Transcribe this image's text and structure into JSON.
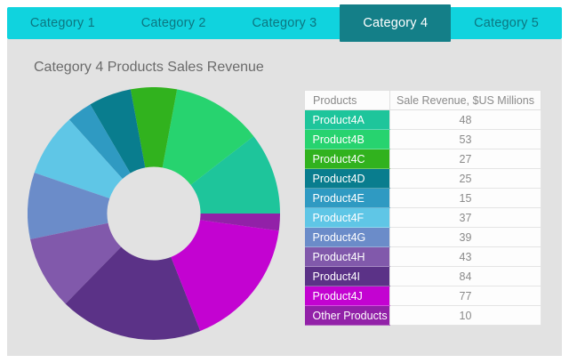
{
  "tabs": {
    "items": [
      {
        "label": "Category 1"
      },
      {
        "label": "Category 2"
      },
      {
        "label": "Category 3"
      },
      {
        "label": "Category 4"
      },
      {
        "label": "Category 5"
      }
    ],
    "active_index": 3
  },
  "main": {
    "title": "Category 4 Products Sales Revenue"
  },
  "table": {
    "headers": [
      "Products",
      "Sale Revenue, $US Millions"
    ],
    "rows": [
      {
        "product": "Product4A",
        "value": 48,
        "color": "#1ec59b"
      },
      {
        "product": "Product4B",
        "value": 53,
        "color": "#27d36f"
      },
      {
        "product": "Product4C",
        "value": 27,
        "color": "#31b21e"
      },
      {
        "product": "Product4D",
        "value": 25,
        "color": "#097d8e"
      },
      {
        "product": "Product4E",
        "value": 15,
        "color": "#2f9ac2"
      },
      {
        "product": "Product4F",
        "value": 37,
        "color": "#5fc6e6"
      },
      {
        "product": "Product4G",
        "value": 39,
        "color": "#6b8cc9"
      },
      {
        "product": "Product4H",
        "value": 43,
        "color": "#8159ab"
      },
      {
        "product": "Product4I",
        "value": 84,
        "color": "#5b3287"
      },
      {
        "product": "Product4J",
        "value": 77,
        "color": "#c303d1"
      },
      {
        "product": "Other Products",
        "value": 10,
        "color": "#9221a8"
      }
    ]
  },
  "chart_data": {
    "type": "pie",
    "subtype": "donut",
    "title": "Category 4 Products Sales Revenue",
    "units": "$US Millions",
    "categories": [
      "Product4A",
      "Product4B",
      "Product4C",
      "Product4D",
      "Product4E",
      "Product4F",
      "Product4G",
      "Product4H",
      "Product4I",
      "Product4J",
      "Other Products"
    ],
    "values": [
      48,
      53,
      27,
      25,
      15,
      37,
      39,
      43,
      84,
      77,
      10
    ],
    "colors": [
      "#1ec59b",
      "#27d36f",
      "#31b21e",
      "#097d8e",
      "#2f9ac2",
      "#5fc6e6",
      "#6b8cc9",
      "#8159ab",
      "#5b3287",
      "#c303d1",
      "#9221a8"
    ],
    "total": 458,
    "start_angle_deg": 0,
    "direction": "counterclockwise",
    "inner_radius_ratio": 0.37,
    "legend_position": "none",
    "data_labels": false
  },
  "colors": {
    "tabbar_bg": "#10d3de",
    "tab_text": "#0c7680",
    "active_tab_bg": "#147f88",
    "active_tab_text": "#ffffff",
    "panel_bg": "#e2e2e2",
    "title_text": "#6b6b6b",
    "table_header_bg": "#fcfcfc",
    "value_cell_bg": "#fdfdfd",
    "table_text": "#8a8a8a"
  }
}
